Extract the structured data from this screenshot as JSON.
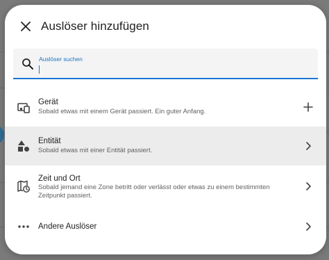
{
  "dialog": {
    "title": "Auslöser hinzufügen",
    "close_icon": "close-icon"
  },
  "search": {
    "label": "Auslöser suchen",
    "value": "",
    "icon": "search-icon",
    "accent_color": "#1976d2"
  },
  "items": [
    {
      "title": "Gerät",
      "description": "Sobald etwas mit einem Gerät passiert. Ein guter Anfang.",
      "icon": "device-icon",
      "action_icon": "plus-icon",
      "selected": false
    },
    {
      "title": "Entität",
      "description": "Sobald etwas mit einer Entität passiert.",
      "icon": "shapes-icon",
      "action_icon": "chevron-right-icon",
      "selected": true
    },
    {
      "title": "Zeit und Ort",
      "description": "Sobald jemand eine Zone betritt oder verlässt oder etwas zu einem bestimmten Zeitpunkt passiert.",
      "icon": "map-clock-icon",
      "action_icon": "chevron-right-icon",
      "selected": false
    },
    {
      "title": "Andere Auslöser",
      "description": "",
      "icon": "more-dots-icon",
      "action_icon": "chevron-right-icon",
      "selected": false
    }
  ]
}
